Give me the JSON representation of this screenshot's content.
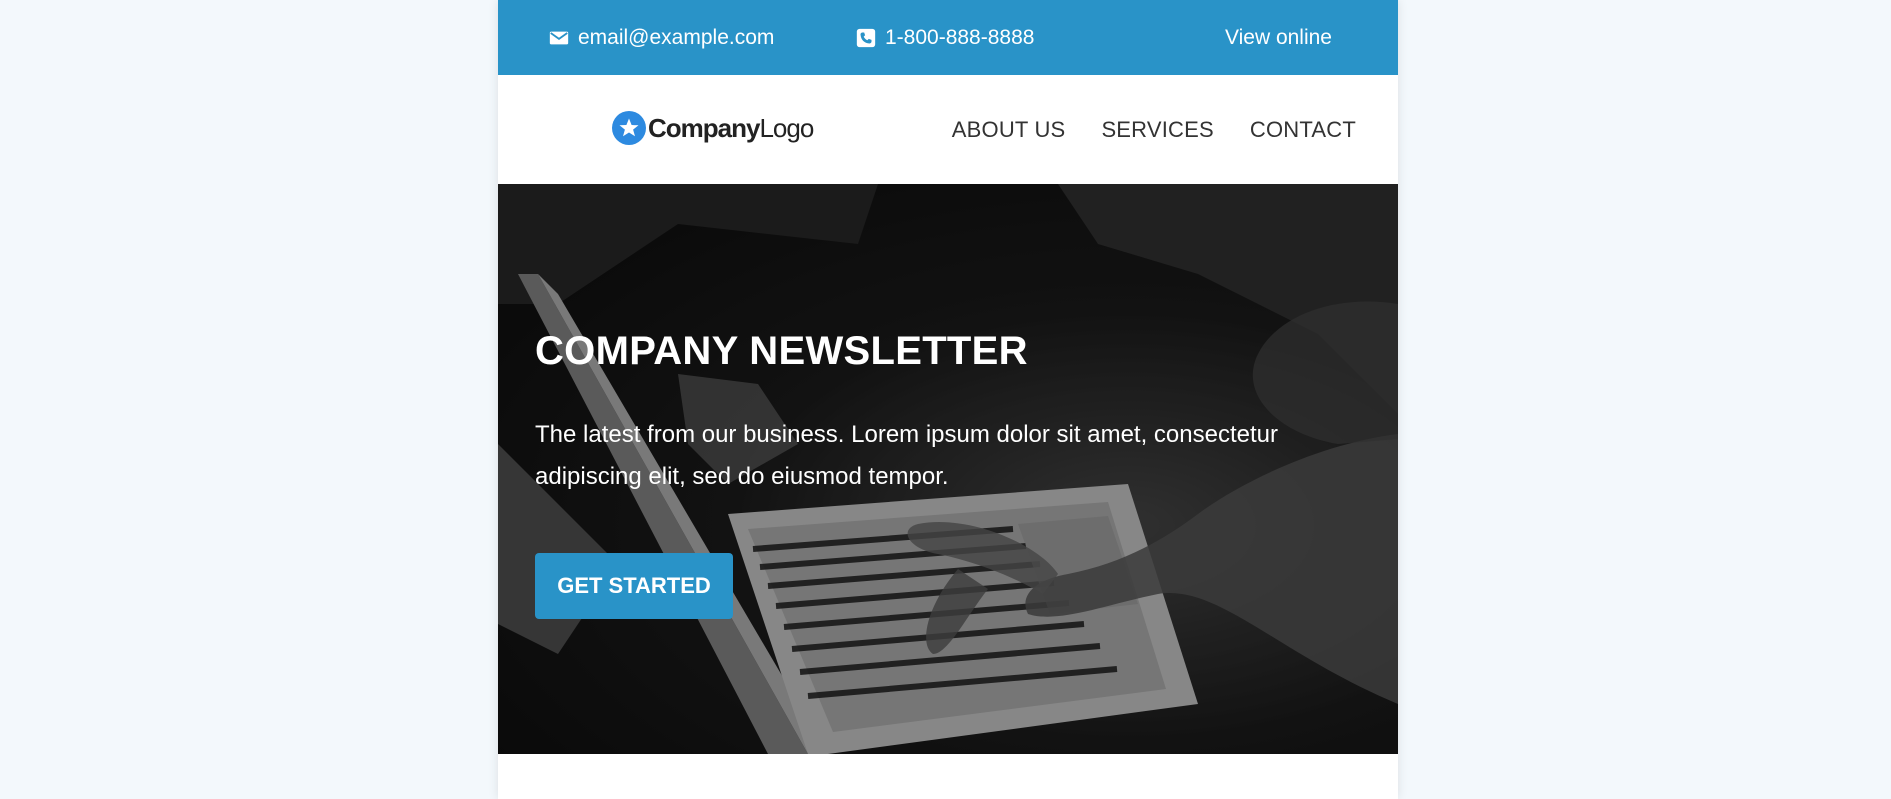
{
  "topbar": {
    "email": "email@example.com",
    "phone": "1-800-888-8888",
    "view_online": "View online",
    "email_icon": "envelope-icon",
    "phone_icon": "phone-icon",
    "background": "#2993c8"
  },
  "header": {
    "logo": {
      "bold": "Company",
      "regular": "Logo",
      "icon": "star-icon",
      "badge_color": "#2d8ae0"
    },
    "nav": [
      {
        "label": "ABOUT US"
      },
      {
        "label": "SERVICES"
      },
      {
        "label": "CONTACT"
      }
    ]
  },
  "hero": {
    "title": "COMPANY NEWSLETTER",
    "text": "The latest from our business. Lorem ipsum dolor sit amet, consectetur adipiscing elit, sed do eiusmod tempor.",
    "cta_label": "GET STARTED",
    "cta_color": "#2993c8"
  }
}
